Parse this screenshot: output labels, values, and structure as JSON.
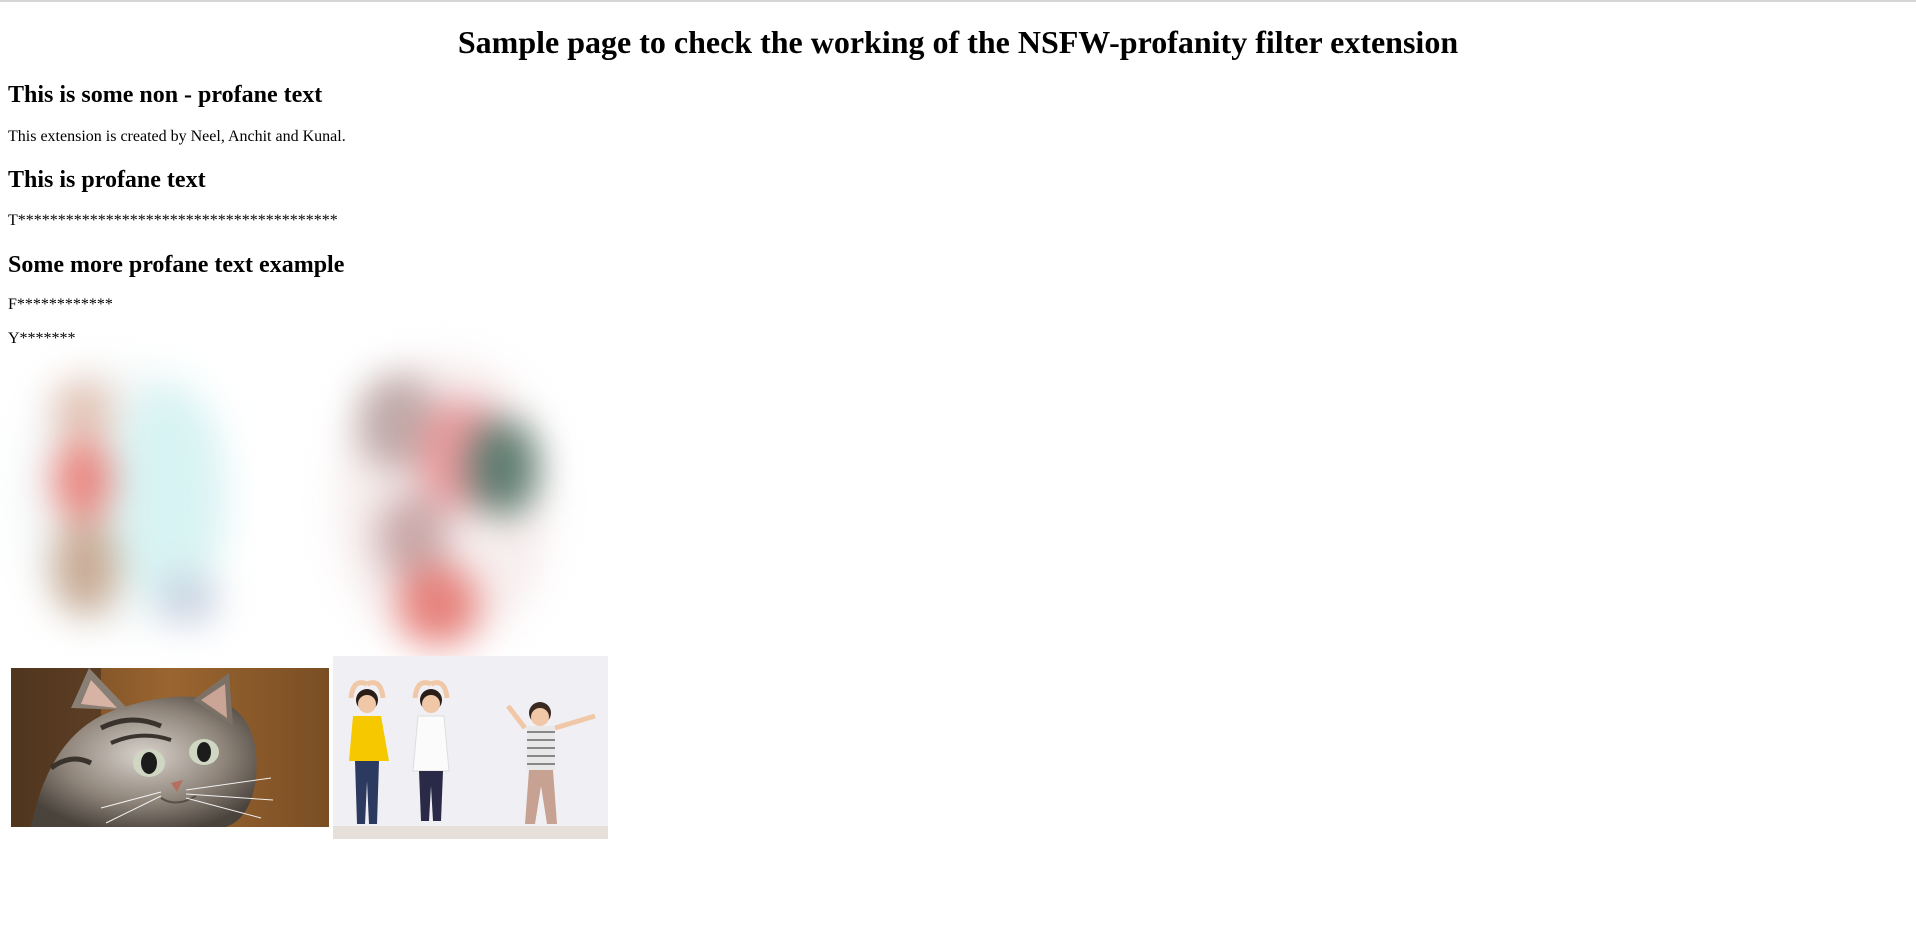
{
  "page": {
    "title": "Sample page to check the working of the NSFW-profanity filter extension",
    "sections": [
      {
        "heading": "This is some non - profane text",
        "text": "This extension is created by Neel, Anchit and Kunal."
      },
      {
        "heading": "This is profane text",
        "text": "T****************************************"
      },
      {
        "heading": "Some more profane text example",
        "lines": [
          "F************",
          "Y*******"
        ]
      }
    ],
    "images": [
      {
        "name": "blurred-image-1",
        "state": "blurred"
      },
      {
        "name": "blurred-image-2",
        "state": "blurred"
      },
      {
        "name": "kitten-image",
        "subject": "tabby kitten"
      },
      {
        "name": "children-image",
        "subject": "three children posing"
      }
    ]
  },
  "colors": {
    "background": "#ffffff",
    "text": "#000000"
  }
}
